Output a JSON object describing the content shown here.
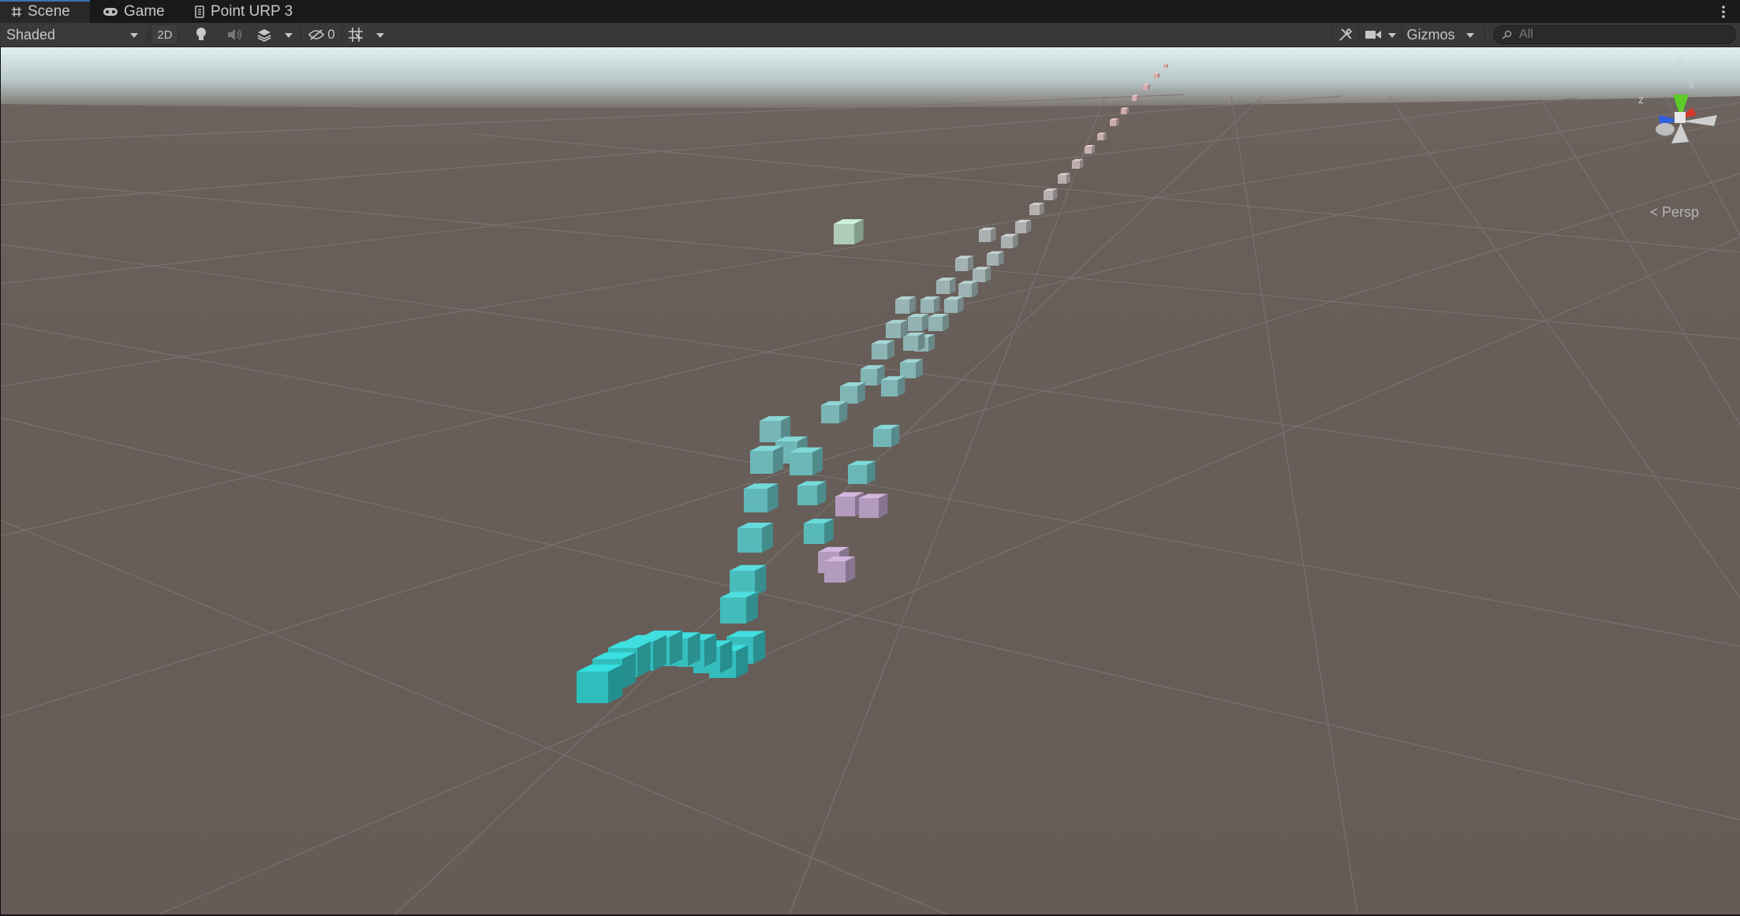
{
  "tabs": [
    {
      "label": "Scene",
      "icon": "grid-icon",
      "active": true
    },
    {
      "label": "Game",
      "icon": "gamepad-icon",
      "active": false
    },
    {
      "label": "Point URP 3",
      "icon": "document-icon",
      "active": false
    }
  ],
  "toolbar": {
    "draw_mode": "Shaded",
    "mode_2d": "2D",
    "hidden_count": "0",
    "gizmos_label": "Gizmos",
    "search_placeholder": "All"
  },
  "scene": {
    "projection_label": "Persp",
    "gizmo_axes": {
      "y": "y",
      "x": "x",
      "z": "z"
    }
  },
  "colors": {
    "sky_top": "#d8ebee",
    "ground": "#675f5a",
    "grid_line": "#7d7672",
    "axis_y": "#5ecb2a",
    "axis_x": "#d9352b",
    "axis_z": "#2f5fe0",
    "cube_teal": "#2ec8c8",
    "cube_pink": "#e8b4b4"
  }
}
